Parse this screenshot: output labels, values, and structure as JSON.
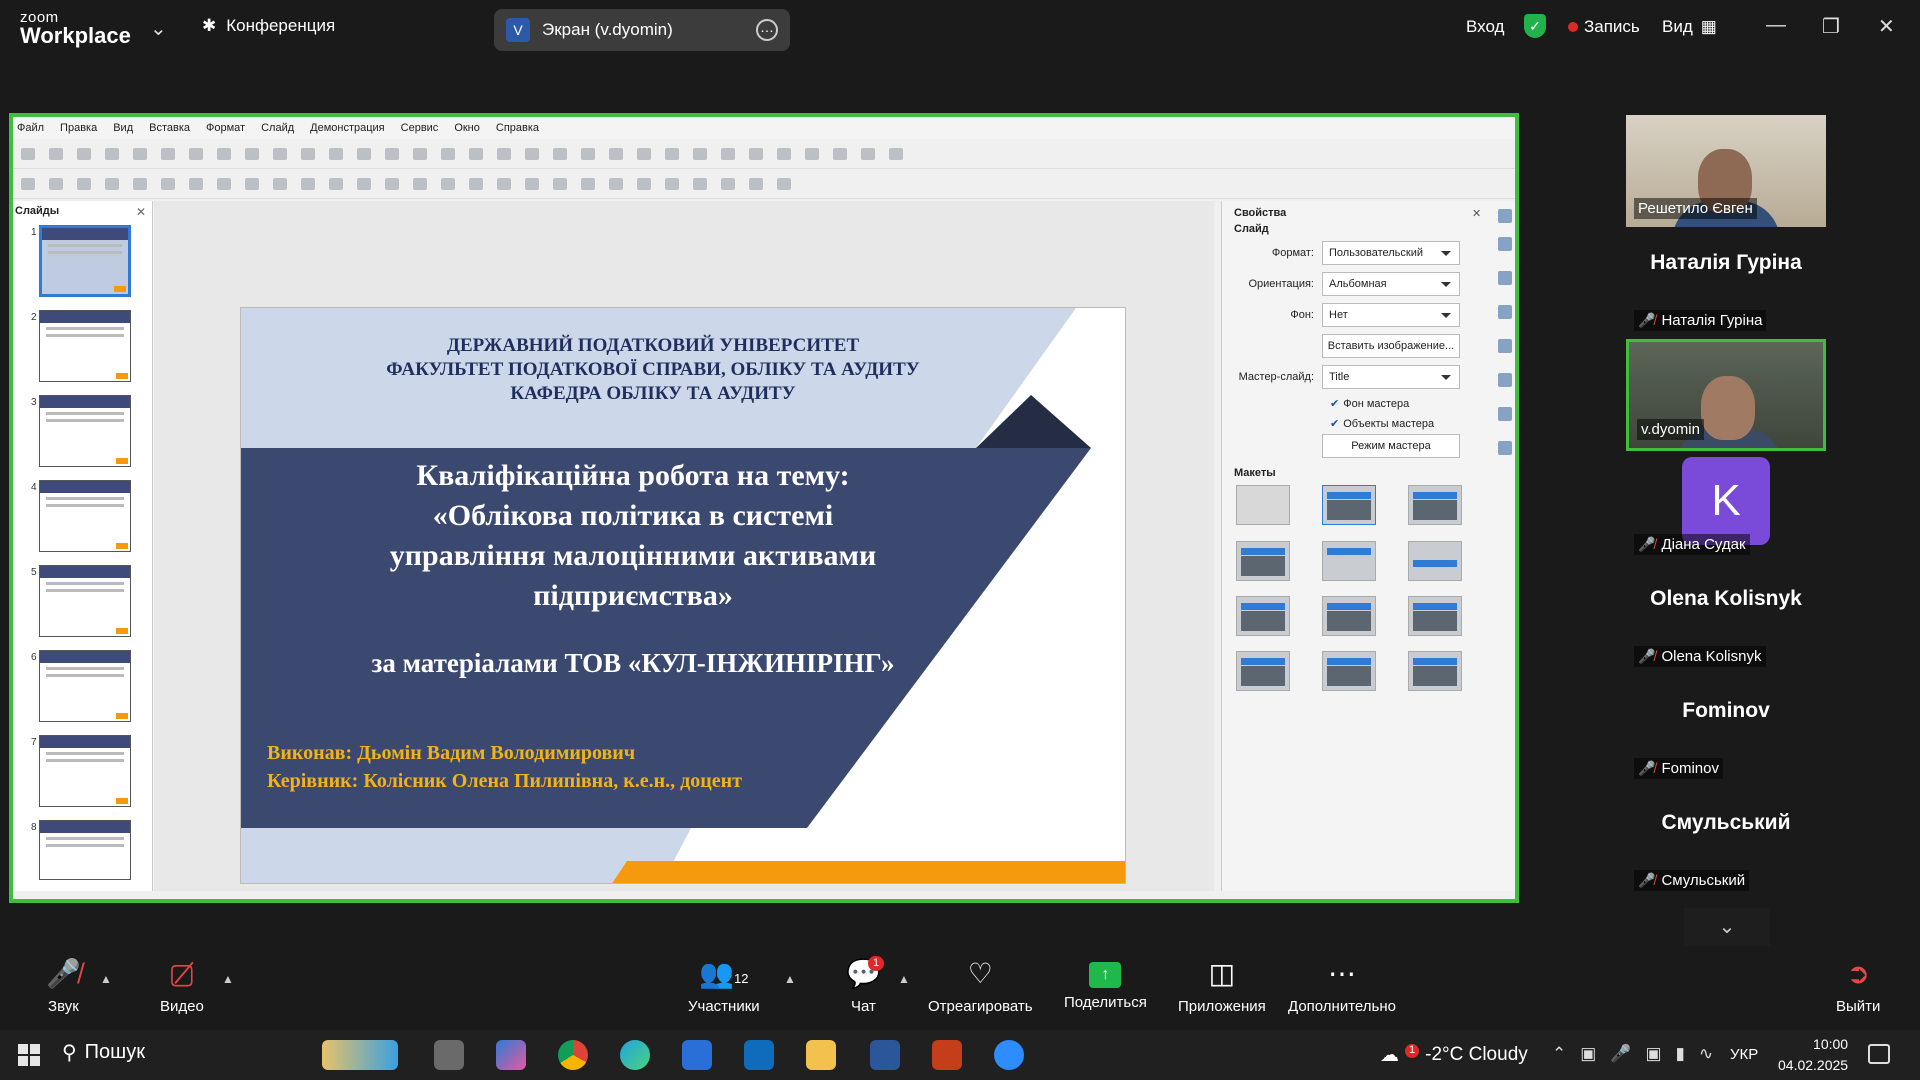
{
  "topbar": {
    "logo_line1": "zoom",
    "logo_line2": "Workplace",
    "meeting_label": "Конференция",
    "share_avatar": "V",
    "share_label": "Экран (v.dyomin)",
    "login": "Вход",
    "record": "Запись",
    "view": "Вид"
  },
  "app": {
    "menu": [
      "Файл",
      "Правка",
      "Вид",
      "Вставка",
      "Формат",
      "Слайд",
      "Демонстрация",
      "Сервис",
      "Окно",
      "Справка"
    ],
    "slides_panel_title": "Слайды",
    "slide_numbers": [
      "1",
      "2",
      "3",
      "4",
      "5",
      "6",
      "7",
      "8"
    ]
  },
  "slide": {
    "university_lines": [
      "ДЕРЖАВНИЙ ПОДАТКОВИЙ УНІВЕРСИТЕТ",
      "ФАКУЛЬТЕТ ПОДАТКОВОЇ СПРАВИ, ОБЛІКУ ТА АУДИТУ",
      "КАФЕДРА ОБЛІКУ ТА АУДИТУ"
    ],
    "theme_lines": [
      "Кваліфікаційна робота на тему:",
      "«Облікова політика в системі",
      "управління малоцінними активами",
      "підприємства»"
    ],
    "material": "за матеріалами ТОВ «КУЛ-ІНЖИНІРІНГ»",
    "author": "Виконав: Дьомін Вадим Володимирович",
    "supervisor": "Керівник: Колісник Олена Пилипівна, к.е.н., доцент",
    "colors": {
      "navy": "#3b4870",
      "light": "#cdd7ea",
      "dark": "#252d45",
      "orange": "#f59a0c",
      "gold": "#f2b21a"
    }
  },
  "properties": {
    "title": "Свойства",
    "section_slide": "Слайд",
    "format_label": "Формат:",
    "format_value": "Пользовательский",
    "orientation_label": "Ориентация:",
    "orientation_value": "Альбомная",
    "background_label": "Фон:",
    "background_value": "Нет",
    "insert_image": "Вставить изображение...",
    "master_label": "Мастер-слайд:",
    "master_value": "Title",
    "chk_master_bg": "Фон мастера",
    "chk_master_objects": "Объекты мастера",
    "master_mode": "Режим мастера",
    "section_layouts": "Макеты"
  },
  "participants": [
    {
      "name": "Решетило Євген",
      "video": true
    },
    {
      "name": "Наталія Гуріна",
      "big": "Наталія Гуріна",
      "muted": true
    },
    {
      "name": "v.dyomin",
      "video": true,
      "active": true
    },
    {
      "name": "Діана Судак",
      "avatar": "K",
      "muted": true
    },
    {
      "name": "Olena Kolisnyk",
      "big": "Olena Kolisnyk",
      "muted": true
    },
    {
      "name": "Fominov",
      "big": "Fominov",
      "muted": true
    },
    {
      "name": "Смульський",
      "big": "Смульський",
      "muted": true
    }
  ],
  "controls": {
    "audio": "Звук",
    "video": "Видео",
    "participants": "Участники",
    "participants_count": "12",
    "chat": "Чат",
    "chat_badge": "1",
    "react": "Отреагировать",
    "share": "Поделиться",
    "apps": "Приложения",
    "more": "Дополнительно",
    "leave": "Выйти"
  },
  "taskbar": {
    "search": "Пошук",
    "weather_badge": "1",
    "weather": "-2°C  Cloudy",
    "lang": "УКР",
    "time": "10:00",
    "date": "04.02.2025"
  }
}
